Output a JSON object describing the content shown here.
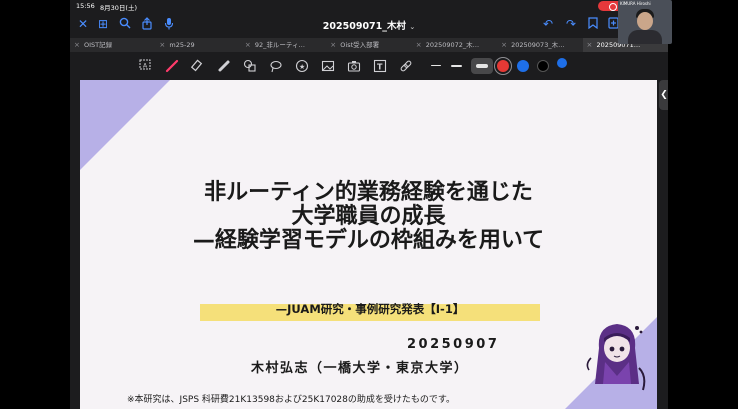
{
  "statusbar": {
    "time": "15:56",
    "date": "8月30日(土)"
  },
  "camera": {
    "name_label": "KIMURA Hiroshi"
  },
  "navbar": {
    "document_title": "202509071_木村",
    "title_chevron": "⌄",
    "icons": [
      "close-icon",
      "grid-icon",
      "search-icon",
      "share-icon",
      "mic-icon",
      "undo-icon",
      "redo-icon",
      "bookmark-icon",
      "add-page-icon"
    ]
  },
  "tabs": [
    {
      "label": "OIST記録",
      "active": false
    },
    {
      "label": "m25-29",
      "active": false
    },
    {
      "label": "92_非ルーティ…",
      "active": false
    },
    {
      "label": "Oist受入部署",
      "active": false
    },
    {
      "label": "202509072_木…",
      "active": false
    },
    {
      "label": "202509073_木…",
      "active": false
    },
    {
      "label": "202509071…",
      "active": true
    }
  ],
  "toolbar": {
    "tools": [
      "lasso-select-icon",
      "pen-icon",
      "eraser-icon",
      "highlighter-icon",
      "shapes-icon",
      "lasso-icon",
      "sticker-icon",
      "image-icon",
      "camera-icon",
      "text-icon",
      "link-icon"
    ],
    "stroke_widths": [
      "thin",
      "medium",
      "thick"
    ],
    "colors": [
      "#e53935",
      "#1e6fe8",
      "#000000",
      "#1e6fe8"
    ]
  },
  "slide": {
    "title_lines": [
      "非ルーティン的業務経験を通じた",
      "大学職員の成長",
      "—経験学習モデルの枠組みを用いて"
    ],
    "subtitle": "—JUAM研究・事例研究発表【I-1】",
    "date": "20250907",
    "author": "木村弘志（一橋大学・東京大学）",
    "footnote": "※本研究は、JSPS 科研費21K13598および25K17028の助成を受けたものです。",
    "accent_color": "#b7b0e7",
    "highlight_color": "#f5e07a"
  },
  "side_handle": {
    "glyph": "❮"
  }
}
